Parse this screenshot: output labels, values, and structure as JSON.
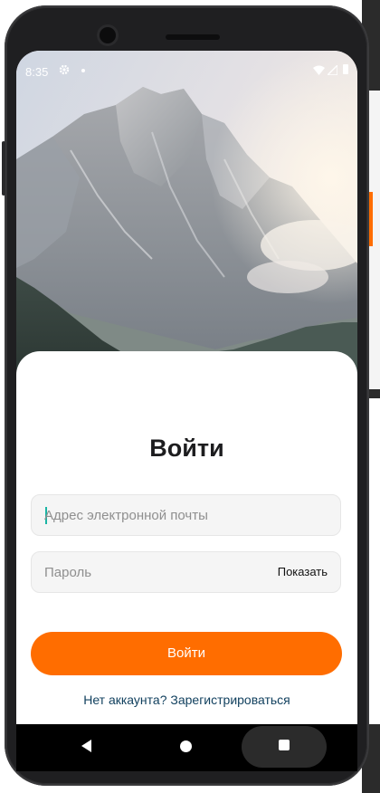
{
  "status_bar": {
    "time": "8:35",
    "icons": [
      "gear-icon",
      "notification-dot-icon",
      "wifi-icon",
      "signal-icon",
      "battery-icon"
    ]
  },
  "login": {
    "title": "Войти",
    "email_placeholder": "Адрес электронной почты",
    "password_placeholder": "Пароль",
    "show_password_label": "Показать",
    "submit_label": "Войти",
    "register_prompt": "Нет аккаунта? Зарегистрироваться"
  },
  "nav_bar": {
    "buttons": [
      "back-icon",
      "home-icon",
      "recents-icon"
    ]
  },
  "colors": {
    "accent": "#ff6d00",
    "link": "#12415f",
    "title": "#1d1d1f",
    "field_bg": "#f5f5f5"
  }
}
